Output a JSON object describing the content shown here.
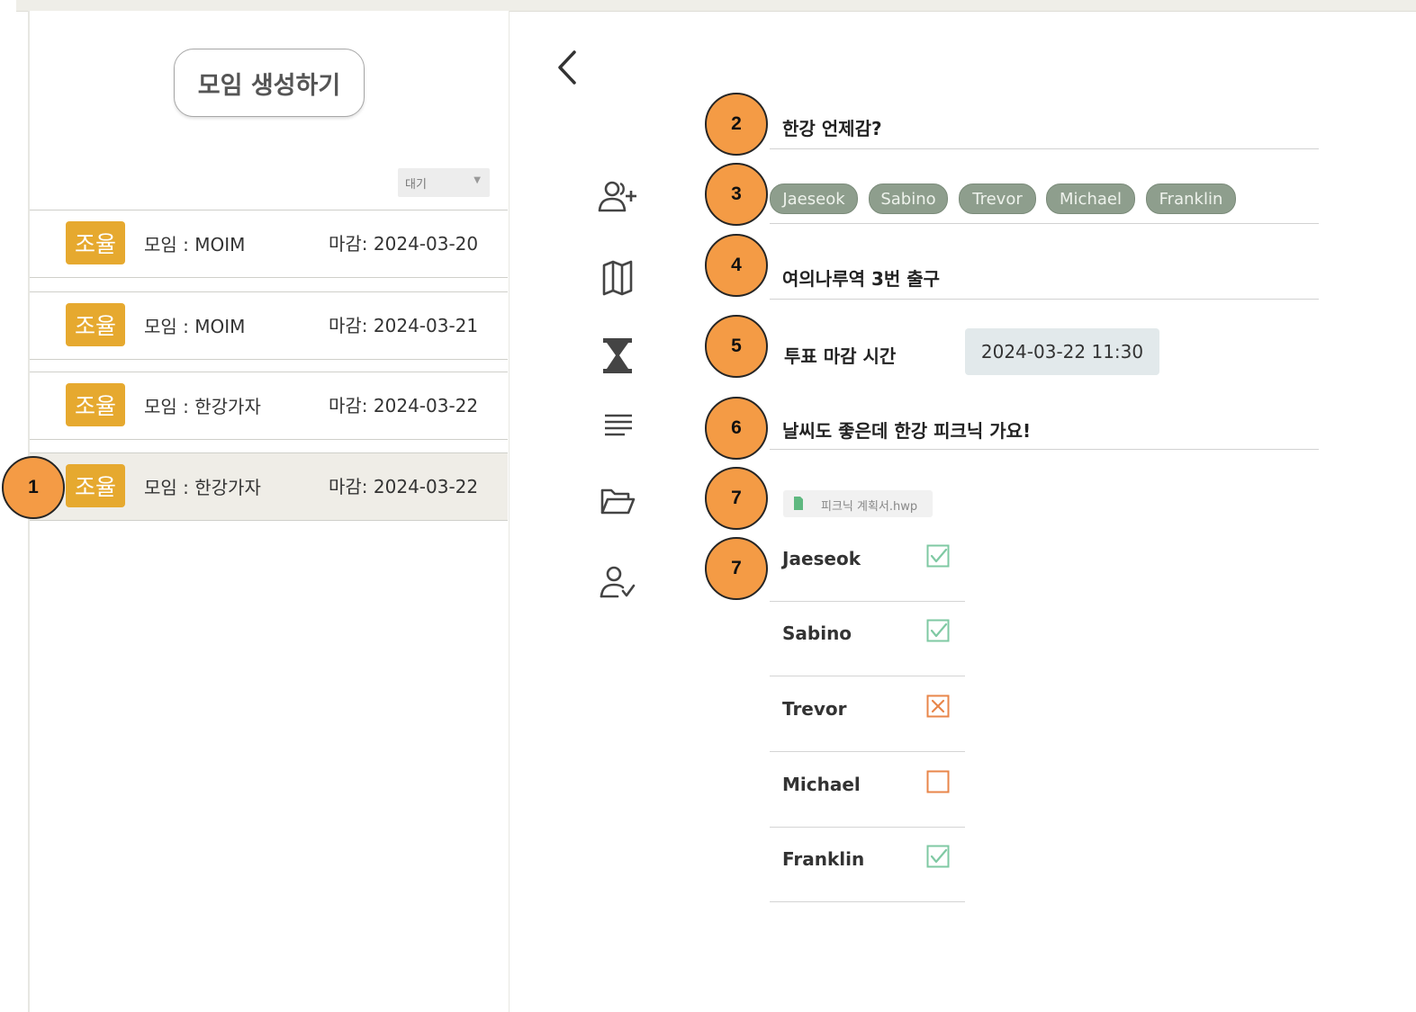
{
  "left": {
    "create_button": "모임 생성하기",
    "status_filter": {
      "selected": "대기",
      "arrow": "▼"
    },
    "meetings": [
      {
        "badge": "조율",
        "name": "모임 : MOIM",
        "deadline": "마감: 2024-03-20"
      },
      {
        "badge": "조율",
        "name": "모임 : MOIM",
        "deadline": "마감: 2024-03-21"
      },
      {
        "badge": "조율",
        "name": "모임 : 한강가자",
        "deadline": "마감: 2024-03-22"
      },
      {
        "badge": "조율",
        "name": "모임 : 한강가자",
        "deadline": "마감: 2024-03-22"
      }
    ],
    "selected_index": 3
  },
  "callouts": [
    "1",
    "2",
    "3",
    "4",
    "5",
    "6",
    "7",
    "7"
  ],
  "detail": {
    "title": "한강 언제감?",
    "members": [
      "Jaeseok",
      "Sabino",
      "Trevor",
      "Michael",
      "Franklin"
    ],
    "location": "여의나루역 3번 출구",
    "vote_deadline_label": "투표 마감 시간",
    "vote_deadline_value": "2024-03-22   11:30",
    "description": "날씨도 좋은데 한강 피크닉 가요!",
    "attachment": "피크닉 계획서.hwp",
    "participants": [
      {
        "name": "Jaeseok",
        "status": "checked"
      },
      {
        "name": "Sabino",
        "status": "checked"
      },
      {
        "name": "Trevor",
        "status": "rejected"
      },
      {
        "name": "Michael",
        "status": "empty"
      },
      {
        "name": "Franklin",
        "status": "checked"
      }
    ]
  },
  "icons": {
    "back": "chevron-left-icon",
    "members": "user-plus-icon",
    "location": "map-icon",
    "deadline": "hourglass-icon",
    "description": "text-lines-icon",
    "attachment": "folder-open-icon",
    "attendance": "user-check-icon"
  },
  "colors": {
    "badge": "#e6a92f",
    "callout": "#f49b45",
    "chip": "#8e9e8d",
    "check_green": "#7fc9a3",
    "reject_orange": "#e8864a",
    "selected_row": "#efede7"
  }
}
